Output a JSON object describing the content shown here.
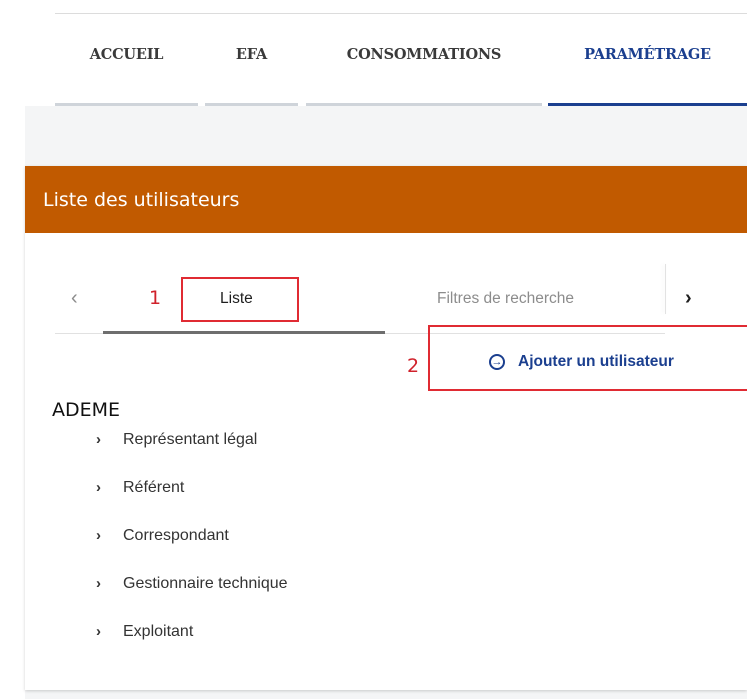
{
  "nav": {
    "tabs": [
      {
        "label": "ACCUEIL"
      },
      {
        "label": "EFA"
      },
      {
        "label": "CONSOMMATIONS"
      },
      {
        "label": "PARAMÉTRAGE"
      }
    ],
    "active_tab": "PARAMÉTRAGE"
  },
  "card": {
    "title": "Liste des utilisateurs",
    "tabs": [
      {
        "label": "Liste"
      },
      {
        "label": "Filtres de recherche"
      }
    ],
    "prev_icon": "chevron-left-icon",
    "next_icon": "chevron-right-icon",
    "add_user_label": "Ajouter un utilisateur",
    "add_user_icon": "circle-arrow-right-icon"
  },
  "annotations": {
    "marker_1": "1",
    "marker_2": "2"
  },
  "organization": {
    "name": "ADEME",
    "roles": [
      {
        "label": "Représentant légal"
      },
      {
        "label": "Référent"
      },
      {
        "label": "Correspondant"
      },
      {
        "label": "Gestionnaire technique"
      },
      {
        "label": "Exploitant"
      }
    ]
  },
  "colors": {
    "header_bg": "#c15a00",
    "accent_blue": "#1b3f8f",
    "annotation_red": "#e02b33"
  }
}
